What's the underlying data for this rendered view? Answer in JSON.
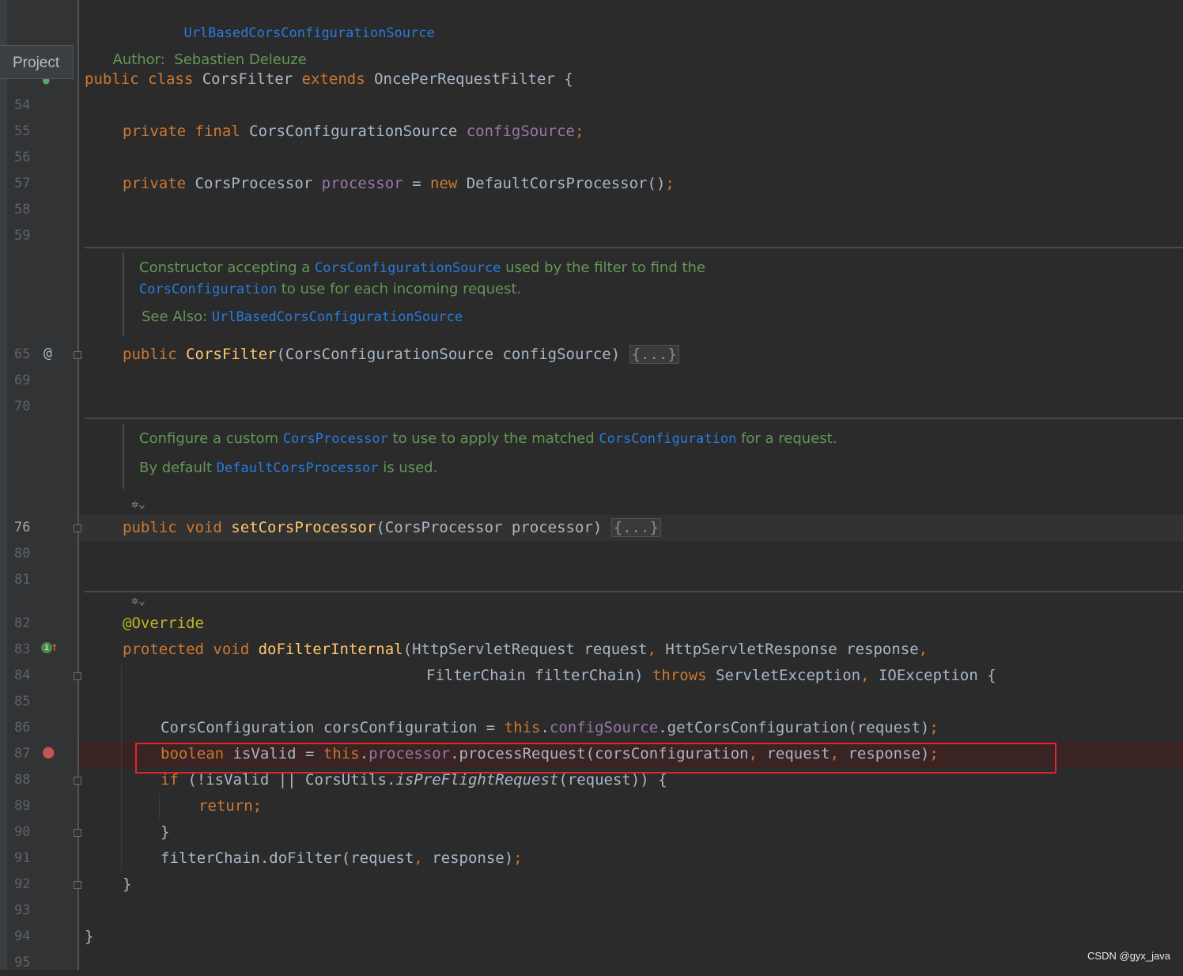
{
  "tool_window": {
    "project_tab": "Project"
  },
  "doc_top": {
    "see_also_link": "UrlBasedCorsConfigurationSource",
    "author_label": "Author:",
    "author_name": "Sebastien Deleuze"
  },
  "line_numbers": {
    "l54": "54",
    "l55": "55",
    "l56": "56",
    "l57": "57",
    "l58": "58",
    "l59": "59",
    "l65": "65",
    "l69": "69",
    "l70": "70",
    "l76": "76",
    "l80": "80",
    "l81": "81",
    "l82": "82",
    "l83": "83",
    "l84": "84",
    "l85": "85",
    "l86": "86",
    "l87": "87",
    "l88": "88",
    "l89": "89",
    "l90": "90",
    "l91": "91",
    "l92": "92",
    "l93": "93",
    "l94": "94",
    "l95": "95"
  },
  "code": {
    "class_decl": {
      "public": "public",
      "class": "class",
      "name": " CorsFilter ",
      "extends": "extends",
      "parent": " OncePerRequestFilter {"
    },
    "line55": {
      "private": "private",
      "final": " final",
      "type": " CorsConfigurationSource ",
      "field": "configSource",
      "semi": ";"
    },
    "line57": {
      "private": "private",
      "type": " CorsProcessor ",
      "field": "processor",
      "eq": " = ",
      "new": "new",
      "rest": " DefaultCorsProcessor()",
      "semi": ";"
    },
    "line65": {
      "public": "public",
      "name": "CorsFilter",
      "params": "(CorsConfigurationSource configSource) ",
      "fold": "{...}"
    },
    "line76": {
      "public": "public",
      "void": " void ",
      "name": "setCorsProcessor",
      "params": "(CorsProcessor processor) ",
      "fold": "{...}"
    },
    "line82": {
      "annotation": "@Override"
    },
    "line83": {
      "protected": "protected",
      "void": " void ",
      "name": "doFilterInternal",
      "p1": "(HttpServletRequest request",
      "c1": ",",
      "p2": " HttpServletResponse response",
      "c2": ","
    },
    "line84": {
      "p3": "FilterChain filterChain) ",
      "throws": "throws",
      "ex1": " ServletException",
      "c": ",",
      "ex2": " IOException {"
    },
    "line86": {
      "decl": "CorsConfiguration corsConfiguration = ",
      "this": "this",
      "dot": ".",
      "field": "configSource",
      "rest": ".getCorsConfiguration(request)",
      "semi": ";"
    },
    "line87": {
      "boolean": "boolean",
      "decl": " isValid = ",
      "this": "this",
      "dot": ".",
      "field": "processor",
      "rest1": ".processRequest(corsConfiguration",
      "c1": ",",
      "rest2": " request",
      "c2": ",",
      "rest3": " response)",
      "semi": ";"
    },
    "line88": {
      "if": "if",
      "cond1": " (!isValid || CorsUtils.",
      "method": "isPreFlightRequest",
      "cond2": "(request)) {"
    },
    "line89": {
      "return": "return",
      "semi": ";"
    },
    "line90": {
      "brace": "}"
    },
    "line91": {
      "call": "filterChain.doFilter(request",
      "c": ",",
      "rest": " response)",
      "semi": ";"
    },
    "line92": {
      "brace": "}"
    },
    "line94": {
      "brace": "}"
    }
  },
  "doc_constructor": {
    "t1": "Constructor accepting a ",
    "link1": "CorsConfigurationSource",
    "t2": " used by the filter to find the",
    "link2": "CorsConfiguration",
    "t3": " to use for each incoming request.",
    "see_also_label": "See Also: ",
    "see_also_link": "UrlBasedCorsConfigurationSource"
  },
  "doc_processor": {
    "t1": "Configure a custom ",
    "link1": "CorsProcessor",
    "t2": " to use to apply the matched ",
    "link2": "CorsConfiguration",
    "t3": " for a request.",
    "t4": "By default ",
    "link3": "DefaultCorsProcessor",
    "t5": " is used."
  },
  "icons": {
    "annotation_gutter": "@",
    "override_gutter": "↑",
    "override_badge": "i",
    "breakpoint": "●",
    "ai_hint": "✲⌄"
  },
  "colors": {
    "background": "#2b2b2b",
    "keyword": "#cc7832",
    "field": "#9876aa",
    "method": "#ffc66d",
    "doc": "#629755",
    "doc_link": "#287bde",
    "annotation": "#bbb529",
    "highlight_box": "#e0252b"
  },
  "watermark": "CSDN @gyx_java"
}
